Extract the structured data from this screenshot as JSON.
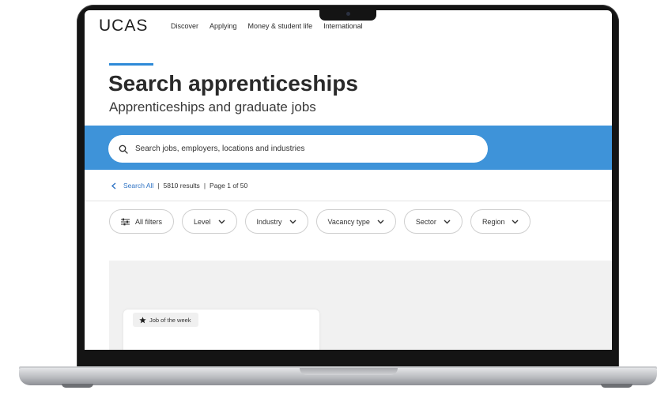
{
  "brand": {
    "logo_text": "UCAS"
  },
  "nav": {
    "items": [
      "Discover",
      "Applying",
      "Money & student life",
      "International"
    ]
  },
  "header": {
    "title": "Search apprenticeships",
    "subtitle": "Apprenticeships and graduate jobs"
  },
  "search": {
    "placeholder": "Search jobs, employers, locations and industries"
  },
  "results": {
    "back_label": "Search All",
    "count_text": "5810 results",
    "page_text": "Page 1 of 50"
  },
  "filters": {
    "all_filters": "All filters",
    "items": [
      "Level",
      "Industry",
      "Vacancy type",
      "Sector",
      "Region"
    ]
  },
  "featured": {
    "badge": "Job of the week"
  },
  "colors": {
    "accent": "#3e93d9",
    "link": "#2e73c4",
    "panel": "#f1f1f1"
  },
  "icons": [
    "search-icon",
    "chevron-left-icon",
    "sliders-icon",
    "chevron-down-icon",
    "star-icon"
  ]
}
